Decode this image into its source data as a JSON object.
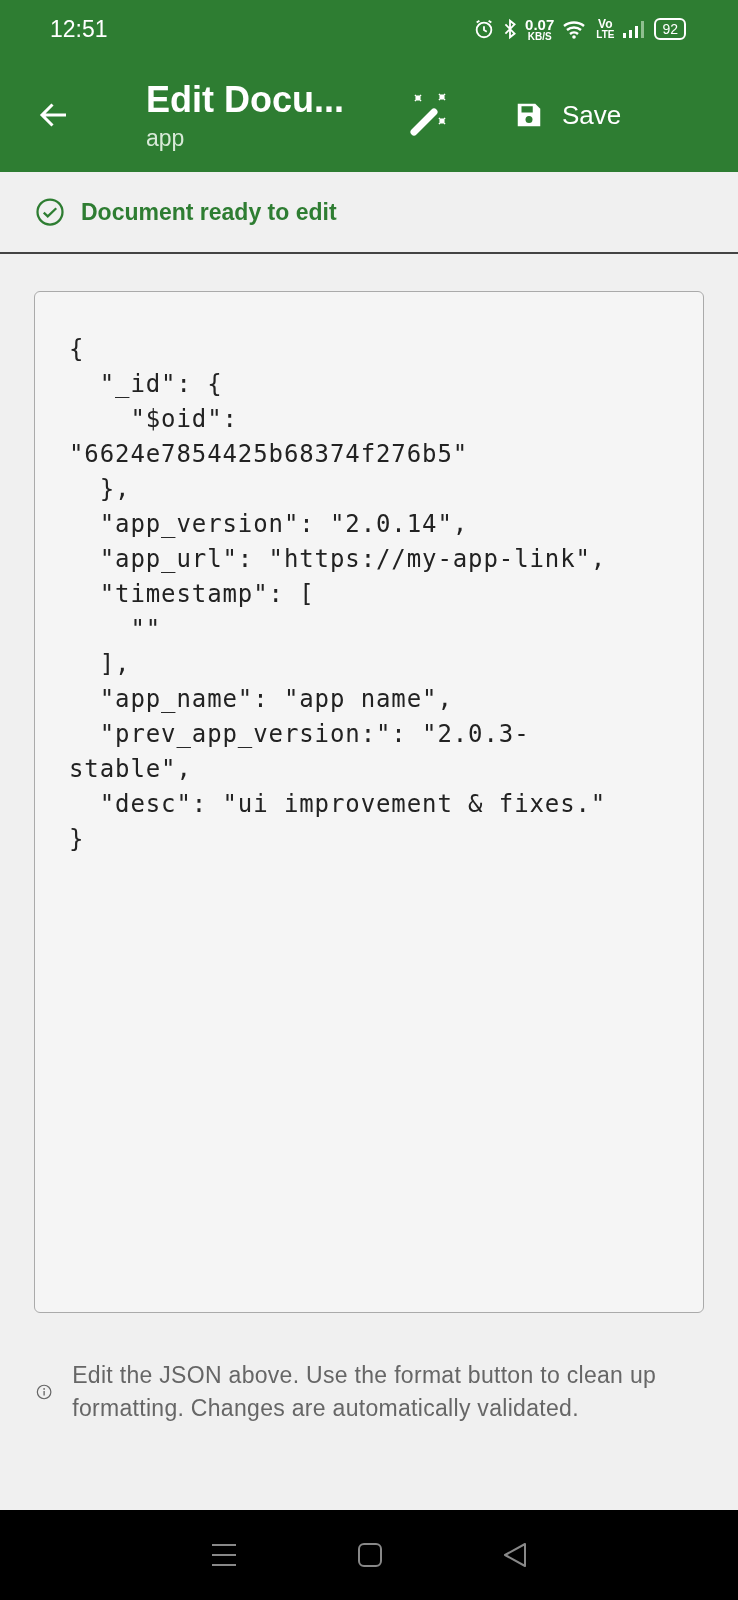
{
  "status_bar": {
    "time": "12:51",
    "net_speed": "0.07",
    "net_unit": "KB/S",
    "volte": "Vo",
    "lte": "LTE",
    "battery": "92"
  },
  "app_bar": {
    "title": "Edit Docu...",
    "subtitle": "app",
    "save_label": "Save"
  },
  "status_message": {
    "kind": "success",
    "text": "Document ready to edit"
  },
  "editor": {
    "lines": [
      "{",
      "  \"_id\": {",
      "    \"$oid\":",
      "\"6624e7854425b68374f276b5\"",
      "  },",
      "  \"app_version\": \"2.0.14\",",
      "  \"app_url\": \"https://my-app-link\",",
      "  \"timestamp\": [",
      "    \"\"",
      "  ],",
      "  \"app_name\": \"app name\",",
      "  \"prev_app_version:\": \"2.0.3-",
      "stable\",",
      "  \"desc\": \"ui improvement & fixes.\"",
      "}"
    ]
  },
  "help_text": "Edit the JSON above. Use the format button to clean up formatting. Changes are automatically validated."
}
